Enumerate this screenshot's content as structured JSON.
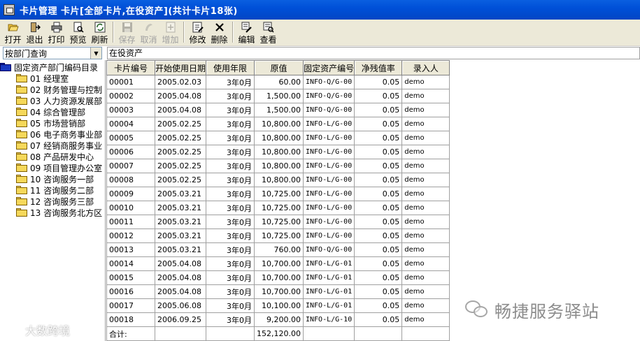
{
  "window": {
    "title": "卡片管理  卡片[全部卡片,在役资产](共计卡片18张)"
  },
  "toolbar": {
    "buttons": [
      {
        "label": "打开",
        "icon": "open-folder-icon",
        "enabled": true
      },
      {
        "label": "退出",
        "icon": "exit-icon",
        "enabled": true
      },
      {
        "label": "打印",
        "icon": "printer-icon",
        "enabled": true
      },
      {
        "label": "预览",
        "icon": "preview-icon",
        "enabled": true
      },
      {
        "label": "刷新",
        "icon": "refresh-icon",
        "enabled": true
      },
      {
        "label": "保存",
        "icon": "save-icon",
        "enabled": false
      },
      {
        "label": "取消",
        "icon": "cancel-icon",
        "enabled": false
      },
      {
        "label": "增加",
        "icon": "add-icon",
        "enabled": false
      },
      {
        "label": "修改",
        "icon": "edit-icon",
        "enabled": true
      },
      {
        "label": "删除",
        "icon": "delete-icon",
        "enabled": true
      },
      {
        "label": "编辑",
        "icon": "edit-menu-icon",
        "enabled": true
      },
      {
        "label": "查看",
        "icon": "view-icon",
        "enabled": true
      }
    ]
  },
  "filter": {
    "selected": "按部门查询"
  },
  "status": {
    "text": "在役资产"
  },
  "tree": {
    "root": "固定资产部门编码目录",
    "items": [
      "01 经理室",
      "02 财务管理与控制",
      "03 人力资源发展部",
      "04 综合管理部",
      "05 市场营销部",
      "06 电子商务事业部",
      "07 经销商服务事业",
      "08 产品研发中心",
      "09 项目管理办公室",
      "10 咨询服务一部",
      "11 咨询服务二部",
      "12 咨询服务三部",
      "13 咨询服务北方区"
    ]
  },
  "table": {
    "columns": [
      "卡片编号",
      "开始使用日期",
      "使用年限",
      "原值",
      "固定资产编号",
      "净残值率",
      "录入人"
    ],
    "rows": [
      [
        "00001",
        "2005.02.03",
        "3年0月",
        "60.00",
        "INFO-Q/G-00",
        "0.05",
        "demo"
      ],
      [
        "00002",
        "2005.04.08",
        "3年0月",
        "1,500.00",
        "INFO-Q/G-00",
        "0.05",
        "demo"
      ],
      [
        "00003",
        "2005.04.08",
        "3年0月",
        "1,500.00",
        "INFO-Q/G-00",
        "0.05",
        "demo"
      ],
      [
        "00004",
        "2005.02.25",
        "3年0月",
        "10,800.00",
        "INFO-L/G-00",
        "0.05",
        "demo"
      ],
      [
        "00005",
        "2005.02.25",
        "3年0月",
        "10,800.00",
        "INFO-L/G-00",
        "0.05",
        "demo"
      ],
      [
        "00006",
        "2005.02.25",
        "3年0月",
        "10,800.00",
        "INFO-L/G-00",
        "0.05",
        "demo"
      ],
      [
        "00007",
        "2005.02.25",
        "3年0月",
        "10,800.00",
        "INFO-L/G-00",
        "0.05",
        "demo"
      ],
      [
        "00008",
        "2005.02.25",
        "3年0月",
        "10,800.00",
        "INFO-L/G-00",
        "0.05",
        "demo"
      ],
      [
        "00009",
        "2005.03.21",
        "3年0月",
        "10,725.00",
        "INFO-L/G-00",
        "0.05",
        "demo"
      ],
      [
        "00010",
        "2005.03.21",
        "3年0月",
        "10,725.00",
        "INFO-L/G-00",
        "0.05",
        "demo"
      ],
      [
        "00011",
        "2005.03.21",
        "3年0月",
        "10,725.00",
        "INFO-L/G-00",
        "0.05",
        "demo"
      ],
      [
        "00012",
        "2005.03.21",
        "3年0月",
        "10,725.00",
        "INFO-L/G-00",
        "0.05",
        "demo"
      ],
      [
        "00013",
        "2005.03.21",
        "3年0月",
        "760.00",
        "INFO-Q/G-00",
        "0.05",
        "demo"
      ],
      [
        "00014",
        "2005.04.08",
        "3年0月",
        "10,700.00",
        "INFO-L/G-01",
        "0.05",
        "demo"
      ],
      [
        "00015",
        "2005.04.08",
        "3年0月",
        "10,700.00",
        "INFO-L/G-01",
        "0.05",
        "demo"
      ],
      [
        "00016",
        "2005.04.08",
        "3年0月",
        "10,700.00",
        "INFO-L/G-01",
        "0.05",
        "demo"
      ],
      [
        "00017",
        "2005.06.08",
        "3年0月",
        "10,100.00",
        "INFO-L/G-01",
        "0.05",
        "demo"
      ],
      [
        "00018",
        "2006.09.25",
        "3年0月",
        "9,200.00",
        "INFO-L/G-10",
        "0.05",
        "demo"
      ]
    ],
    "total_label": "合计:",
    "total_value": "152,120.00"
  },
  "watermarks": {
    "right": "畅捷服务驿站",
    "left": "大数跨境"
  }
}
